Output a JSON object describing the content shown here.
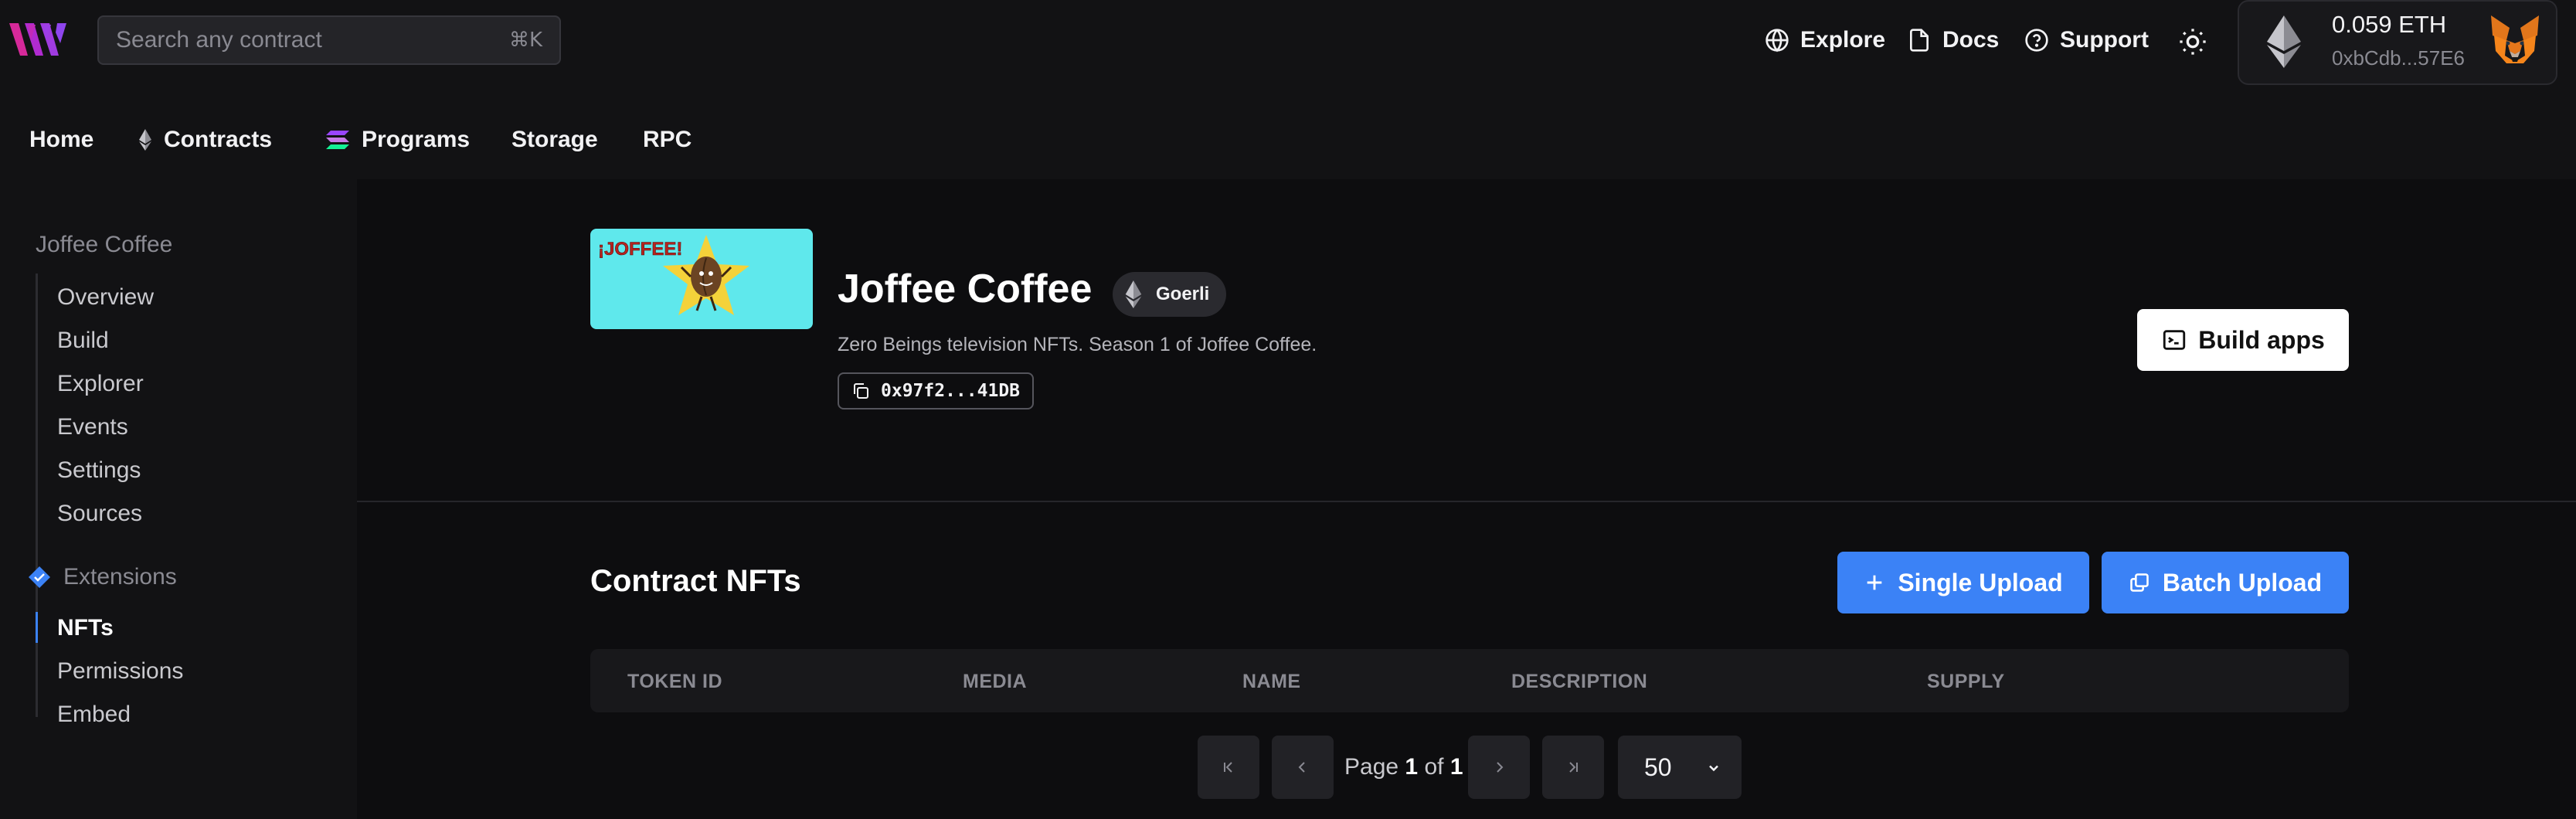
{
  "header": {
    "search_placeholder": "Search any contract",
    "search_shortcut": "⌘K",
    "links": [
      {
        "label": "Explore",
        "icon": "globe-icon"
      },
      {
        "label": "Docs",
        "icon": "document-icon"
      },
      {
        "label": "Support",
        "icon": "help-circle-icon"
      }
    ],
    "theme_icon": "sun-icon",
    "wallet": {
      "balance": "0.059 ETH",
      "address": "0xbCdb...57E6",
      "icon": "metamask-fox-icon"
    }
  },
  "nav": {
    "tabs": [
      {
        "label": "Home"
      },
      {
        "label": "Contracts",
        "icon": "ethereum-icon"
      },
      {
        "label": "Programs",
        "icon": "solana-icon"
      },
      {
        "label": "Storage"
      },
      {
        "label": "RPC"
      }
    ]
  },
  "sidebar": {
    "contract_heading": "Joffee Coffee",
    "items": [
      "Overview",
      "Build",
      "Explorer",
      "Events",
      "Settings",
      "Sources"
    ],
    "extensions_heading": "Extensions",
    "extension_items": [
      "NFTs",
      "Permissions",
      "Embed"
    ],
    "active_item": "NFTs"
  },
  "contract": {
    "thumbnail_text": "¡JOFFEE!",
    "name": "Joffee Coffee",
    "network": "Goerli",
    "description": "Zero Beings television NFTs. Season 1 of Joffee Coffee.",
    "address": "0x97f2...41DB",
    "build_apps_label": "Build apps"
  },
  "nfts": {
    "title": "Contract NFTs",
    "single_upload_label": "Single Upload",
    "batch_upload_label": "Batch Upload",
    "columns": [
      "TOKEN ID",
      "MEDIA",
      "NAME",
      "DESCRIPTION",
      "SUPPLY"
    ],
    "rows": []
  },
  "pagination": {
    "page_label": "Page",
    "current_page": "1",
    "of_label": "of",
    "total_pages": "1",
    "page_size": "50"
  },
  "colors": {
    "accent": "#3b82f6",
    "background": "#121214",
    "panel": "#0d0d0f"
  }
}
